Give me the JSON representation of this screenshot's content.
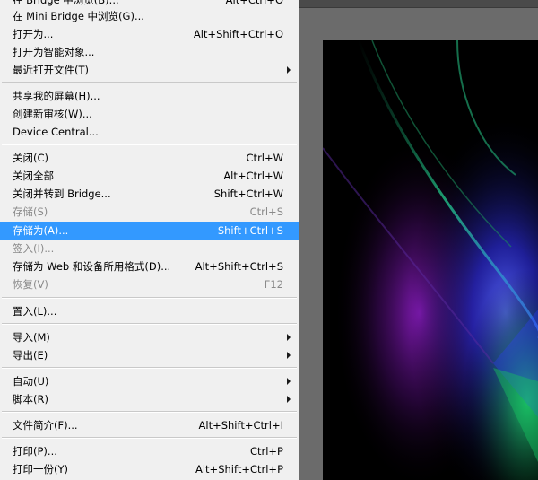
{
  "menu": {
    "items": [
      {
        "label": "在 Bridge 中浏览(B)...",
        "shortcut": "Alt+Ctrl+O",
        "state": "normal"
      },
      {
        "label": "在 Mini Bridge 中浏览(G)...",
        "shortcut": "",
        "state": "normal"
      },
      {
        "label": "打开为...",
        "shortcut": "Alt+Shift+Ctrl+O",
        "state": "normal"
      },
      {
        "label": "打开为智能对象...",
        "shortcut": "",
        "state": "normal"
      },
      {
        "label": "最近打开文件(T)",
        "shortcut": "",
        "state": "normal",
        "submenu": true
      },
      {
        "label": "共享我的屏幕(H)...",
        "shortcut": "",
        "state": "normal"
      },
      {
        "label": "创建新审核(W)...",
        "shortcut": "",
        "state": "normal"
      },
      {
        "label": "Device Central...",
        "shortcut": "",
        "state": "normal"
      },
      {
        "label": "关闭(C)",
        "shortcut": "Ctrl+W",
        "state": "normal"
      },
      {
        "label": "关闭全部",
        "shortcut": "Alt+Ctrl+W",
        "state": "normal"
      },
      {
        "label": "关闭并转到 Bridge...",
        "shortcut": "Shift+Ctrl+W",
        "state": "normal"
      },
      {
        "label": "存储(S)",
        "shortcut": "Ctrl+S",
        "state": "disabled"
      },
      {
        "label": "存储为(A)...",
        "shortcut": "Shift+Ctrl+S",
        "state": "highlight"
      },
      {
        "label": "签入(I)...",
        "shortcut": "",
        "state": "disabled"
      },
      {
        "label": "存储为 Web 和设备所用格式(D)...",
        "shortcut": "Alt+Shift+Ctrl+S",
        "state": "normal"
      },
      {
        "label": "恢复(V)",
        "shortcut": "F12",
        "state": "disabled"
      },
      {
        "label": "置入(L)...",
        "shortcut": "",
        "state": "normal"
      },
      {
        "label": "导入(M)",
        "shortcut": "",
        "state": "normal",
        "submenu": true
      },
      {
        "label": "导出(E)",
        "shortcut": "",
        "state": "normal",
        "submenu": true
      },
      {
        "label": "自动(U)",
        "shortcut": "",
        "state": "normal",
        "submenu": true
      },
      {
        "label": "脚本(R)",
        "shortcut": "",
        "state": "normal",
        "submenu": true
      },
      {
        "label": "文件简介(F)...",
        "shortcut": "Alt+Shift+Ctrl+I",
        "state": "normal"
      },
      {
        "label": "打印(P)...",
        "shortcut": "Ctrl+P",
        "state": "normal"
      },
      {
        "label": "打印一份(Y)",
        "shortcut": "Alt+Shift+Ctrl+P",
        "state": "normal"
      }
    ]
  },
  "colors": {
    "menu_bg": "#f0f0f0",
    "highlight": "#3399ff",
    "disabled_text": "#8a8a8a",
    "workspace": "#6b6b6b"
  }
}
